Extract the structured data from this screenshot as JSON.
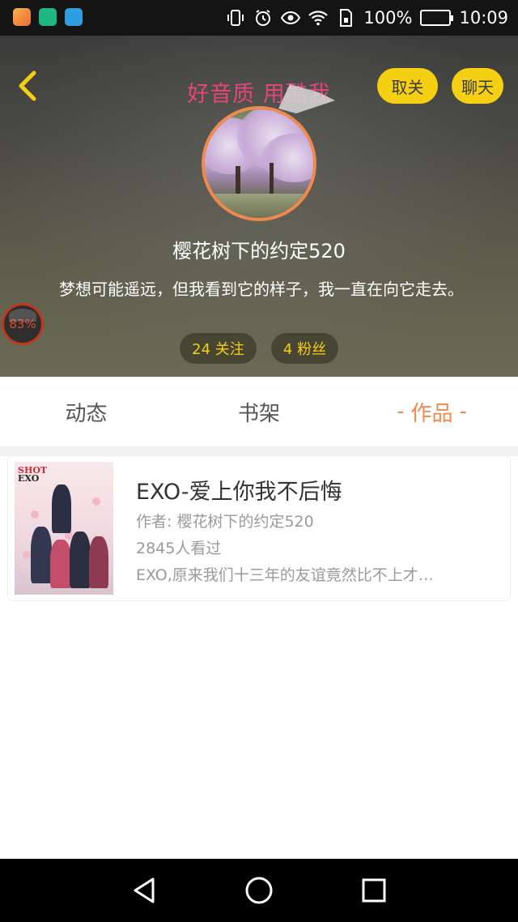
{
  "status_bar": {
    "battery_percent": "100%",
    "time": "10:09",
    "left_icons": [
      "gallery-app-icon",
      "shield-app-icon",
      "health-app-icon"
    ],
    "right_icons": [
      "vibrate-icon",
      "alarm-icon",
      "eye-icon",
      "wifi-icon",
      "sim-icon",
      "battery-icon"
    ],
    "battery_color": "#39c21c"
  },
  "header": {
    "promo_text": "好音质 用酷我",
    "unfollow_label": "取关",
    "chat_label": "聊天",
    "username": "樱花树下的约定520",
    "bio": "梦想可能遥远，但我看到它的样子，我一直在向它走去。",
    "follow_count": "24 关注",
    "fans_count": "4 粉丝",
    "float_badge": "83%",
    "accent_color": "#f5d012",
    "avatar_ring_color": "#f08a4c"
  },
  "tabs": [
    {
      "label": "动态",
      "active": false
    },
    {
      "label": "书架",
      "active": false
    },
    {
      "label": "作品",
      "active": true,
      "dash": "-"
    }
  ],
  "works": [
    {
      "cover_logo_top": "SHOT",
      "cover_logo_main": "EXO",
      "title": "EXO-爱上你我不后悔",
      "author": "作者: 樱花树下的约定520",
      "views": "2845人看过",
      "summary": "EXO,原来我们十三年的友谊竟然比不上才…"
    }
  ],
  "nav_bar": {
    "buttons": [
      "back-triangle-icon",
      "home-circle-icon",
      "recents-square-icon"
    ]
  }
}
